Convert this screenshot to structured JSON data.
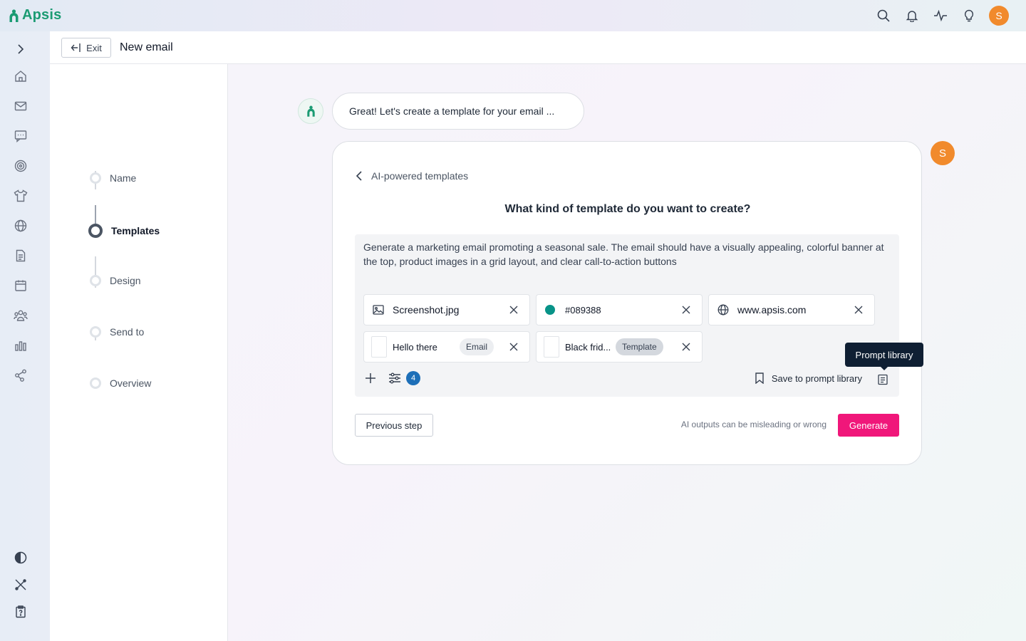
{
  "app": {
    "name": "Apsis",
    "user_initial": "S"
  },
  "header": {
    "exit_label": "Exit",
    "title": "New email"
  },
  "steps": [
    {
      "label": "Name",
      "state": "pending"
    },
    {
      "label": "Templates",
      "state": "active"
    },
    {
      "label": "Design",
      "state": "pending"
    },
    {
      "label": "Send to",
      "state": "pending"
    },
    {
      "label": "Overview",
      "state": "pending"
    }
  ],
  "chat": {
    "bot_message": "Great! Let's create a template for your email ...",
    "user_initial": "S"
  },
  "card": {
    "back_label": "AI-powered templates",
    "question": "What kind of template do you want to create?",
    "prompt": "Generate a marketing email promoting a seasonal sale. The email should have a visually appealing, colorful banner at the top, product images in a grid layout, and clear call-to-action buttons",
    "chips": {
      "image": "Screenshot.jpg",
      "color": "#089388",
      "color_swatch": "#089388",
      "website": "www.apsis.com",
      "email_name": "Hello there",
      "email_tag": "Email",
      "template_name": "Black frid...",
      "template_tag": "Template"
    },
    "settings_count": "4",
    "save_label": "Save to prompt library",
    "tooltip": "Prompt library",
    "previous_label": "Previous step",
    "disclaimer": "AI outputs can be misleading or wrong",
    "generate_label": "Generate"
  },
  "colors": {
    "brand": "#1b9b73",
    "accent": "#f0177a",
    "avatar": "#f18a2c",
    "badge": "#1d6fb8"
  }
}
